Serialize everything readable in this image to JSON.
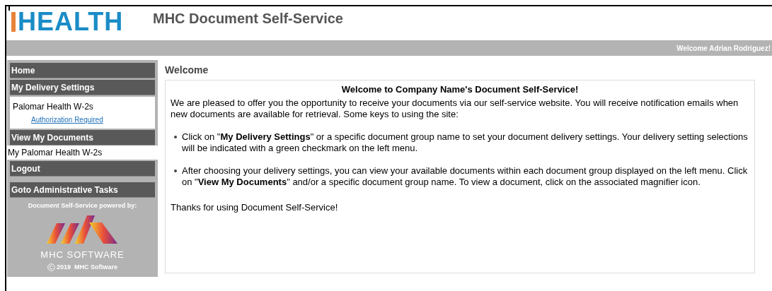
{
  "logo": {
    "text": "HEALTH"
  },
  "header": {
    "title": "MHC Document Self-Service"
  },
  "top_bar": {
    "welcome": "Welcome Adrian Rodriguez!"
  },
  "sidebar": {
    "items": [
      {
        "kind": "header",
        "label": "Home"
      },
      {
        "kind": "header",
        "label": "My Delivery Settings"
      },
      {
        "kind": "group",
        "label": "Palomar Health W-2s",
        "link": "Authorization Required"
      },
      {
        "kind": "header",
        "label": "View My Documents"
      },
      {
        "kind": "plain",
        "label": "My Palomar Health W-2s"
      },
      {
        "kind": "header",
        "label": "Logout"
      },
      {
        "kind": "header",
        "label": "Goto Administrative Tasks"
      }
    ],
    "powered_by": "Document Self-Service powered by:",
    "brand": "MHC SOFTWARE",
    "copyright": "2019  MHC Software"
  },
  "main": {
    "heading": "Welcome",
    "title": "Welcome to Company Name's Document Self-Service!",
    "intro": "We are pleased to offer you the opportunity to receive your documents via our self-service website. You will receive notification emails when new documents are available for retrieval. Some keys to using the site:",
    "bullets": [
      "Click on \"**My Delivery Settings**\" or a specific document group name to set your document delivery settings. Your delivery setting selections will be indicated with a green checkmark on the left menu.",
      "After choosing your delivery settings, you can view your available documents within each document group displayed on the left menu. Click on \"**View My Documents**\" and/or a specific document group name. To view a document, click on the associated magnifier icon."
    ],
    "closing": "Thanks for using Document Self-Service!"
  }
}
